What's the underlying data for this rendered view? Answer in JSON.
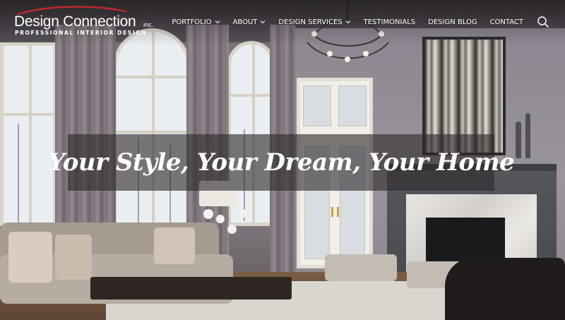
{
  "logo": {
    "name": "Design Connection",
    "suffix": "inc.",
    "tagline": "PROFESSIONAL INTERIOR DESIGN",
    "swoosh_color": "#c0282d"
  },
  "nav": {
    "items": [
      {
        "label": "PORTFOLIO",
        "dropdown": true
      },
      {
        "label": "ABOUT",
        "dropdown": true
      },
      {
        "label": "DESIGN SERVICES",
        "dropdown": true
      },
      {
        "label": "TESTIMONIALS",
        "dropdown": false
      },
      {
        "label": "DESIGN BLOG",
        "dropdown": false
      },
      {
        "label": "CONTACT",
        "dropdown": false
      }
    ],
    "search_icon": "search-icon",
    "dropdown_icon": "chevron-down-icon"
  },
  "hero": {
    "headline": "Your Style, Your Dream, Your Home",
    "image": "interior-living-room-photo"
  },
  "colors": {
    "text": "#ffffff",
    "band": "#2d2a2c",
    "brand_accent": "#c0282d"
  }
}
